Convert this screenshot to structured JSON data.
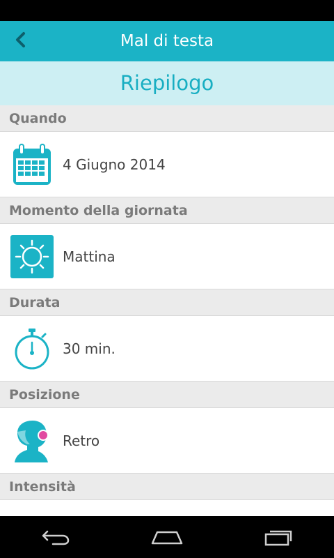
{
  "header": {
    "title": "Mal di testa"
  },
  "subheader": {
    "title": "Riepilogo"
  },
  "sections": [
    {
      "label": "Quando",
      "value": "4 Giugno 2014",
      "icon": "calendar-icon"
    },
    {
      "label": "Momento della giornata",
      "value": "Mattina",
      "icon": "sun-icon"
    },
    {
      "label": "Durata",
      "value": "30 min.",
      "icon": "stopwatch-icon"
    },
    {
      "label": "Posizione",
      "value": "Retro",
      "icon": "head-back-icon"
    },
    {
      "label": "Intensità"
    }
  ],
  "colors": {
    "accent": "#1bb3c6",
    "accent_light": "#cdeff3",
    "marker": "#e14aa0"
  }
}
